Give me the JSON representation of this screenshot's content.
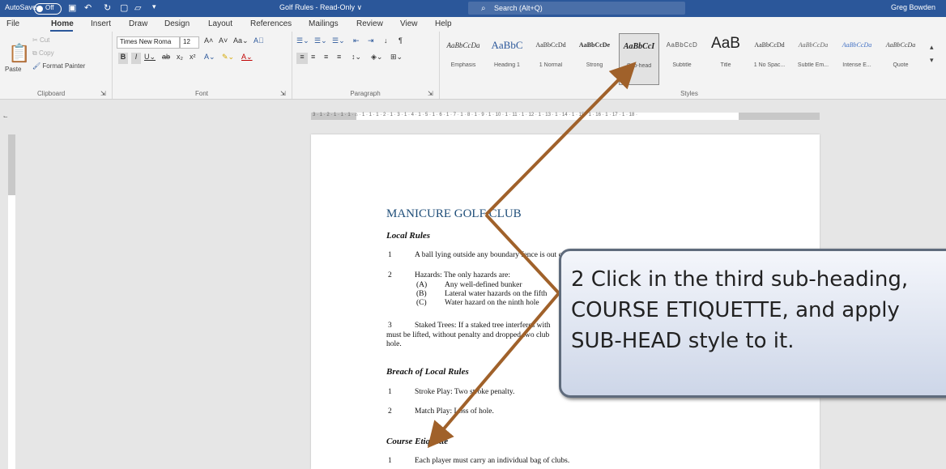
{
  "titlebar": {
    "autosave_label": "AutoSave",
    "autosave_state": "Off",
    "doc_title": "Golf Rules - Read-Only ∨",
    "search_placeholder": "Search (Alt+Q)",
    "user_name": "Greg Bowden"
  },
  "menu": {
    "tabs": [
      "File",
      "Home",
      "Insert",
      "Draw",
      "Design",
      "Layout",
      "References",
      "Mailings",
      "Review",
      "View",
      "Help"
    ],
    "active_tab": "Home"
  },
  "ribbon": {
    "clipboard": {
      "paste": "Paste",
      "cut": "Cut",
      "copy": "Copy",
      "format_painter": "Format Painter",
      "group_label": "Clipboard"
    },
    "font": {
      "font_name": "Times New Roma",
      "font_size": "12",
      "group_label": "Font"
    },
    "paragraph": {
      "group_label": "Paragraph"
    },
    "styles": {
      "group_label": "Styles",
      "items": [
        {
          "preview": "AaBbCcDa",
          "name": "Emphasis"
        },
        {
          "preview": "AaBbC",
          "name": "Heading 1"
        },
        {
          "preview": "AaBbCcDd",
          "name": "1 Normal"
        },
        {
          "preview": "AaBbCcDe",
          "name": "Strong"
        },
        {
          "preview": "AaBbCcI",
          "name": "Sub-head"
        },
        {
          "preview": "AaBbCcD",
          "name": "Subtitle"
        },
        {
          "preview": "AaB",
          "name": "Title"
        },
        {
          "preview": "AaBbCcDd",
          "name": "1 No Spac..."
        },
        {
          "preview": "AaBbCcDa",
          "name": "Subtle Em..."
        },
        {
          "preview": "AaBbCcDa",
          "name": "Intense E..."
        },
        {
          "preview": "AaBbCcDa",
          "name": "Quote"
        }
      ],
      "selected": "Sub-head"
    }
  },
  "ruler": {
    "ticks": "3 · 1 · 2 · 1 · 1 · 1 · ⌂ · 1 · 1 · 1 · 2 · 1 · 3 · 1 · 4 · 1 · 5 · 1 · 6 · 1 · 7 · 1 · 8 · 1 · 9 · 1 · 10 · 1 · 11 · 1 · 12 · 1 · 13 · 1 · 14 · 1 · 15 · 1 · 16 · 1 · 17 · 1 · 18 ·"
  },
  "document": {
    "club_title": "MANICURE GOLF CLUB",
    "local_rules_heading": "Local Rules",
    "rule1_num": "1",
    "rule1_text": "A ball lying outside any boundary fence is out of bounds. Penalty: Stroke and Distance.",
    "rule2_num": "2",
    "rule2_text": "Hazards: The only hazards are:",
    "rule2_a": "(A)",
    "rule2_a_text": "Any well-defined bunker",
    "rule2_b": "(B)",
    "rule2_b_text": "Lateral water hazards on the fifth",
    "rule2_c": "(C)",
    "rule2_c_text": "Water hazard on the ninth hole",
    "rule3_num": "3",
    "rule3_text": "Staked Trees: If a staked tree interferes with",
    "rule3_line2": "must be lifted, without penalty and dropped two club",
    "rule3_line3": "hole.",
    "breach_heading": "Breach of Local Rules",
    "breach1_num": "1",
    "breach1_text": "Stroke Play: Two stroke penalty.",
    "breach2_num": "2",
    "breach2_text": "Match Play: Loss of hole.",
    "course_heading": "Course Etiquette",
    "course1_num": "1",
    "course1_text": "Each player must carry an individual bag of clubs."
  },
  "callout": {
    "line1": "2  Click in the third sub-heading,",
    "line2": "    COURSE ETIQUETTE, and apply",
    "line3": "    SUB-HEAD style to it."
  },
  "colors": {
    "titlebar": "#2b579a",
    "arrow": "#a0612a",
    "doc_title": "#1f4e79"
  }
}
